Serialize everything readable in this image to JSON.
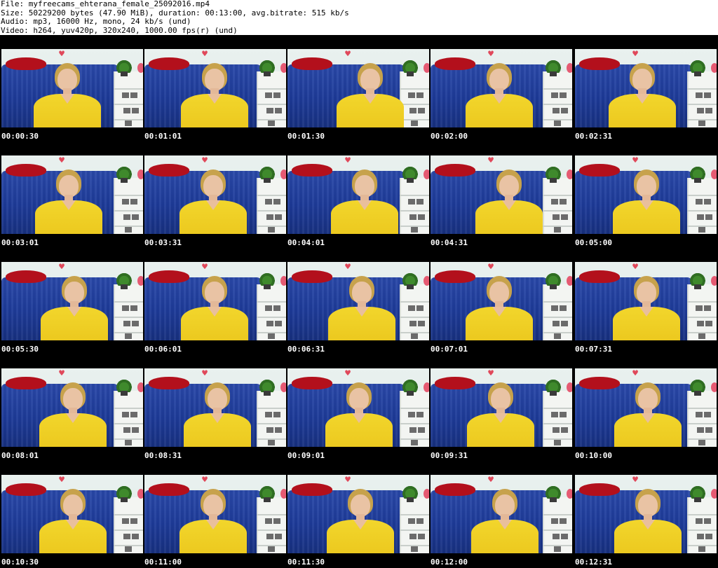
{
  "header": {
    "file_line": "File: myfreecams_ehterana_female_25092016.mp4",
    "size_line": "Size: 50229200 bytes (47.90 MiB), duration: 00:13:00, avg.bitrate: 515 kb/s",
    "audio_line": "Audio: mp3, 16000 Hz, mono, 24 kb/s (und)",
    "video_line": "Video: h264, yuv420p, 320x240, 1000.00 fps(r) (und)"
  },
  "thumbnails": [
    {
      "timestamp": "00:00:30"
    },
    {
      "timestamp": "00:01:01"
    },
    {
      "timestamp": "00:01:30"
    },
    {
      "timestamp": "00:02:00"
    },
    {
      "timestamp": "00:02:31"
    },
    {
      "timestamp": "00:03:01"
    },
    {
      "timestamp": "00:03:31"
    },
    {
      "timestamp": "00:04:01"
    },
    {
      "timestamp": "00:04:31"
    },
    {
      "timestamp": "00:05:00"
    },
    {
      "timestamp": "00:05:30"
    },
    {
      "timestamp": "00:06:01"
    },
    {
      "timestamp": "00:06:31"
    },
    {
      "timestamp": "00:07:01"
    },
    {
      "timestamp": "00:07:31"
    },
    {
      "timestamp": "00:08:01"
    },
    {
      "timestamp": "00:08:31"
    },
    {
      "timestamp": "00:09:01"
    },
    {
      "timestamp": "00:09:31"
    },
    {
      "timestamp": "00:10:00"
    },
    {
      "timestamp": "00:10:30"
    },
    {
      "timestamp": "00:11:00"
    },
    {
      "timestamp": "00:11:30"
    },
    {
      "timestamp": "00:12:00"
    },
    {
      "timestamp": "00:12:31"
    }
  ]
}
